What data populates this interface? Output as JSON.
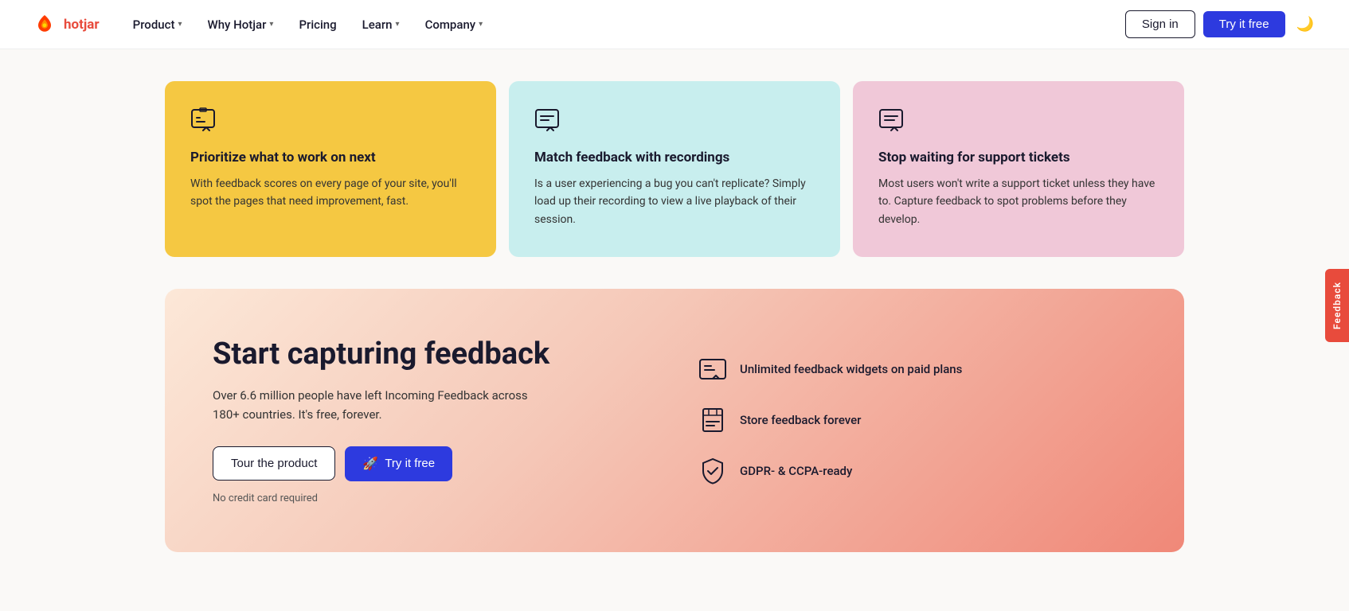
{
  "nav": {
    "logo_text": "hotjar",
    "items": [
      {
        "id": "product",
        "label": "Product",
        "has_dropdown": true
      },
      {
        "id": "why-hotjar",
        "label": "Why Hotjar",
        "has_dropdown": true
      },
      {
        "id": "pricing",
        "label": "Pricing",
        "has_dropdown": false
      },
      {
        "id": "learn",
        "label": "Learn",
        "has_dropdown": true
      },
      {
        "id": "company",
        "label": "Company",
        "has_dropdown": true
      }
    ],
    "sign_in_label": "Sign in",
    "try_free_label": "Try it free"
  },
  "cards": [
    {
      "id": "prioritize",
      "color": "yellow",
      "title": "Prioritize what to work on next",
      "body": "With feedback scores on every page of your site, you'll spot the pages that need improvement, fast."
    },
    {
      "id": "match-feedback",
      "color": "cyan",
      "title": "Match feedback with recordings",
      "body": "Is a user experiencing a bug you can't replicate? Simply load up their recording to view a live playback of their session."
    },
    {
      "id": "support-tickets",
      "color": "pink",
      "title": "Stop waiting for support tickets",
      "body": "Most users won't write a support ticket unless they have to. Capture feedback to spot problems before they develop."
    }
  ],
  "cta": {
    "heading": "Start capturing feedback",
    "subtext": "Over 6.6 million people have left Incoming Feedback across 180+ countries. It's free, forever.",
    "tour_label": "Tour the product",
    "try_label": "Try it free",
    "no_cc_label": "No credit card required",
    "features": [
      {
        "id": "unlimited",
        "text": "Unlimited feedback widgets on paid plans"
      },
      {
        "id": "store",
        "text": "Store feedback forever"
      },
      {
        "id": "gdpr",
        "text": "GDPR- & CCPA-ready"
      }
    ]
  },
  "feedback_tab": {
    "label": "Feedback"
  }
}
